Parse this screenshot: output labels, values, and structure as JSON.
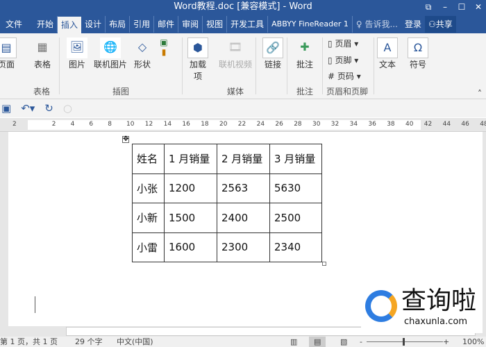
{
  "window": {
    "title": "Word教程.doc [兼容模式] - Word",
    "controls": [
      "⧉",
      "–",
      "☐",
      "✕"
    ]
  },
  "tabs": [
    {
      "label": "文件"
    },
    {
      "label": "开始"
    },
    {
      "label": "插入",
      "active": true
    },
    {
      "label": "设计"
    },
    {
      "label": "布局"
    },
    {
      "label": "引用"
    },
    {
      "label": "邮件"
    },
    {
      "label": "审阅"
    },
    {
      "label": "视图"
    },
    {
      "label": "开发工具"
    },
    {
      "label": "ABBYY FineReader 1"
    }
  ],
  "tell_me": "告诉我...",
  "login": "登录",
  "share": "共享",
  "ribbon": {
    "buttons": {
      "page": "页面",
      "table": "表格",
      "picture": "图片",
      "online_picture": "联机图片",
      "shapes": "形状",
      "addins": "加载项",
      "online_video": "联机视频",
      "link": "链接",
      "comment": "批注",
      "header": "页眉",
      "footer": "页脚",
      "page_number": "页码",
      "text": "文本",
      "symbol": "符号"
    },
    "groups": {
      "tables": "表格",
      "illustrations": "插图",
      "media": "媒体",
      "comments": "批注",
      "header_footer": "页眉和页脚"
    }
  },
  "ruler": {
    "ticks": [
      "2",
      "2",
      "4",
      "6",
      "8",
      "10",
      "12",
      "14",
      "16",
      "18",
      "20",
      "22",
      "24",
      "26",
      "28",
      "30",
      "32",
      "34",
      "36",
      "38",
      "40",
      "42",
      "44",
      "46",
      "48"
    ]
  },
  "table": {
    "rows": [
      [
        "姓名",
        "1 月销量",
        "2 月销量",
        "3 月销量"
      ],
      [
        "小张",
        "1200",
        "2563",
        "5630"
      ],
      [
        "小新",
        "1500",
        "2400",
        "2500"
      ],
      [
        "小雷",
        "1600",
        "2300",
        "2340"
      ]
    ]
  },
  "status": {
    "page": "第 1 页，共 1 页",
    "words": "29 个字",
    "language": "中文(中国)",
    "zoom": "100%"
  },
  "watermark": {
    "text": "查询啦",
    "url": "chaxunla.com"
  },
  "colors": {
    "accent": "#2b579a"
  }
}
